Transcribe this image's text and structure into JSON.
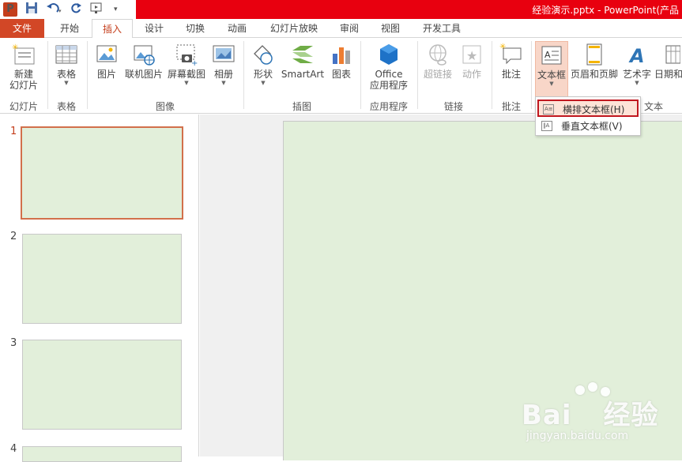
{
  "window": {
    "title": "经验演示.pptx -  PowerPoint(产品"
  },
  "tabs": [
    "文件",
    "开始",
    "插入",
    "设计",
    "切换",
    "动画",
    "幻灯片放映",
    "审阅",
    "视图",
    "开发工具"
  ],
  "ribbon": {
    "new_slide": "新建\n幻灯片",
    "new_slide_line1": "新建",
    "new_slide_line2": "幻灯片",
    "table": "表格",
    "picture": "图片",
    "online_picture": "联机图片",
    "screenshot": "屏幕截图",
    "album": "相册",
    "shapes": "形状",
    "smartart": "SmartArt",
    "chart": "图表",
    "office_line1": "Office",
    "office_line2": "应用程序",
    "hyperlink": "超链接",
    "action": "动作",
    "comment": "批注",
    "textbox": "文本框",
    "header_footer": "页眉和页脚",
    "wordart": "艺术字",
    "datetime": "日期和",
    "groups": {
      "slides": "幻灯片",
      "tables": "表格",
      "images": "图像",
      "illustrations": "插图",
      "apps": "应用程序",
      "links": "链接",
      "comments": "批注",
      "text": "文本"
    }
  },
  "dropdown": {
    "horizontal": "横排文本框(H)",
    "vertical": "垂直文本框(V)"
  },
  "slides": {
    "numbers": [
      "1",
      "2",
      "3",
      "4"
    ]
  },
  "watermark": {
    "brand": "Bai",
    "brand2": "经验",
    "url": "jingyan.baidu.com"
  },
  "colors": {
    "accent": "#c43e1c",
    "file_tab": "#d24726",
    "titlebar": "#e8000f",
    "slide_bg": "#e2efda",
    "highlight_border": "#c0171f"
  }
}
